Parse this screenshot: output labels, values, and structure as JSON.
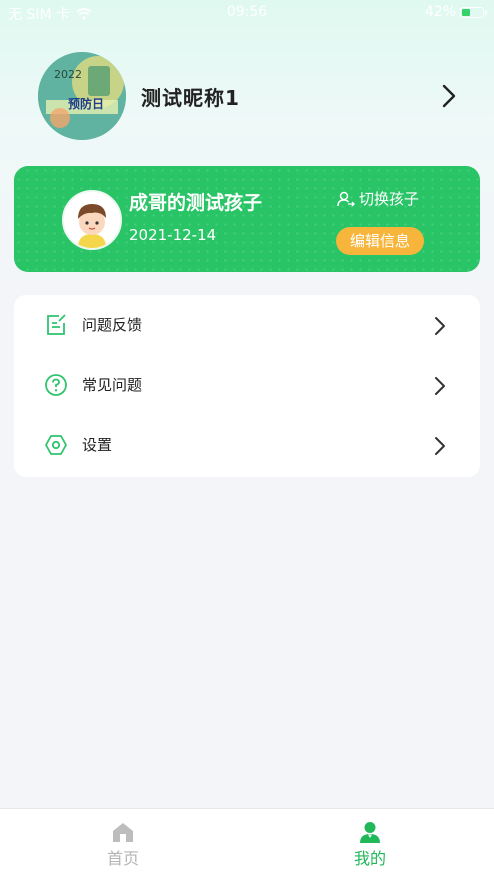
{
  "status_bar": {
    "carrier": "无 SIM 卡",
    "time": "09:56",
    "battery": "42%",
    "battery_level": 0.42
  },
  "profile": {
    "avatar_icon": "avatar-image",
    "avatar_text_year": "2022",
    "avatar_text_title": "预防日",
    "nickname": "测试昵称1"
  },
  "child_card": {
    "name": "成哥的测试孩子",
    "birthday": "2021-12-14",
    "switch_label": "切换孩子",
    "edit_label": "编辑信息",
    "colors": {
      "card": "#28c466",
      "edit_button": "#f7b53b"
    }
  },
  "menu": {
    "items": [
      {
        "label": "问题反馈",
        "icon": "feedback-icon"
      },
      {
        "label": "常见问题",
        "icon": "question-icon"
      },
      {
        "label": "设置",
        "icon": "settings-icon"
      }
    ]
  },
  "tabs": [
    {
      "label": "首页",
      "icon": "home-icon",
      "active": false
    },
    {
      "label": "我的",
      "icon": "profile-icon",
      "active": true
    }
  ],
  "colors": {
    "accent": "#21b85a",
    "inactive": "#b5b5b5"
  }
}
